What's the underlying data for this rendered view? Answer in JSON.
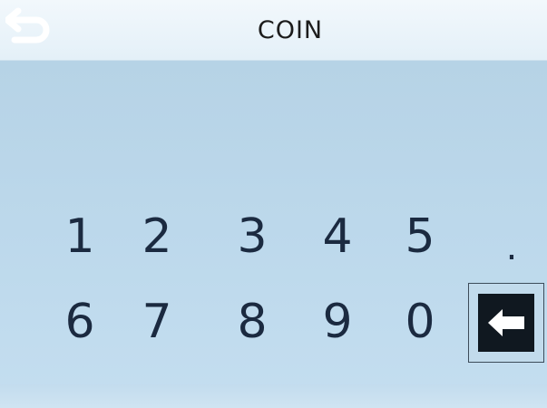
{
  "header": {
    "title": "COIN",
    "back_icon": "back-arrow-icon"
  },
  "keypad": {
    "row1": [
      "1",
      "2",
      "3",
      "4",
      "5",
      "."
    ],
    "row2": [
      "6",
      "7",
      "8",
      "9",
      "0"
    ],
    "backspace_icon": "backspace-arrow-icon"
  },
  "colors": {
    "header_bg": "#eef6fb",
    "screen_bg": "#b8d4e6",
    "key_text": "#1b2a40",
    "backspace_bg": "#101820"
  }
}
